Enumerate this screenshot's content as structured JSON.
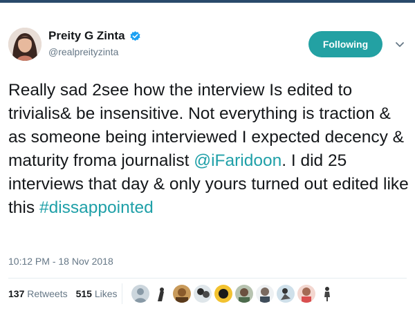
{
  "user": {
    "name": "Preity G Zinta",
    "handle": "@realpreityzinta"
  },
  "follow_button": "Following",
  "tweet": {
    "part1": "Really sad 2see how the interview Is edited to trivialis& be insensitive. Not everything is traction & as someone being interviewed I expected decency & maturity froma journalist ",
    "mention": "@iFaridoon",
    "part2": ". I did 25 interviews that day & only yours turned out edited like this ",
    "hashtag": "#dissappointed"
  },
  "timestamp": "10:12 PM - 18 Nov 2018",
  "stats": {
    "retweets_count": "137",
    "retweets_label": "Retweets",
    "likes_count": "515",
    "likes_label": "Likes"
  },
  "colors": {
    "accent": "#23a1a3",
    "link": "#1fa0a8",
    "muted": "#657786"
  },
  "icons": {
    "verified": "verified-badge-icon",
    "menu": "chevron-down-icon"
  }
}
